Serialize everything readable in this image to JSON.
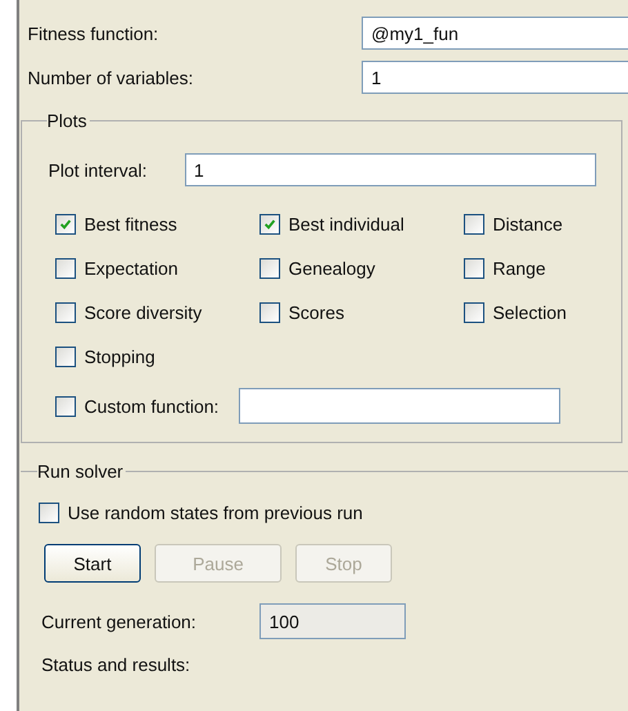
{
  "fitness_function": {
    "label": "Fitness function:",
    "value": "@my1_fun"
  },
  "number_of_variables": {
    "label": "Number of variables:",
    "value": "1"
  },
  "plots": {
    "title": "Plots",
    "plot_interval": {
      "label": "Plot interval:",
      "value": "1"
    },
    "options": [
      {
        "label": "Best fitness",
        "checked": true
      },
      {
        "label": "Best individual",
        "checked": true
      },
      {
        "label": "Distance",
        "checked": false
      },
      {
        "label": "Expectation",
        "checked": false
      },
      {
        "label": "Genealogy",
        "checked": false
      },
      {
        "label": "Range",
        "checked": false
      },
      {
        "label": "Score diversity",
        "checked": false
      },
      {
        "label": "Scores",
        "checked": false
      },
      {
        "label": "Selection",
        "checked": false
      },
      {
        "label": "Stopping",
        "checked": false
      }
    ],
    "custom_function": {
      "label": "Custom function:",
      "checked": false
    }
  },
  "run_solver": {
    "title": "Run solver",
    "use_random_states": {
      "label": "Use random states from previous run",
      "checked": false
    },
    "buttons": [
      {
        "label": "Start",
        "disabled": false
      },
      {
        "label": "Pause",
        "disabled": true
      },
      {
        "label": "Stop",
        "disabled": true
      }
    ],
    "current_generation": {
      "label": "Current generation:",
      "value": "100"
    },
    "status_label": "Status and results:"
  }
}
